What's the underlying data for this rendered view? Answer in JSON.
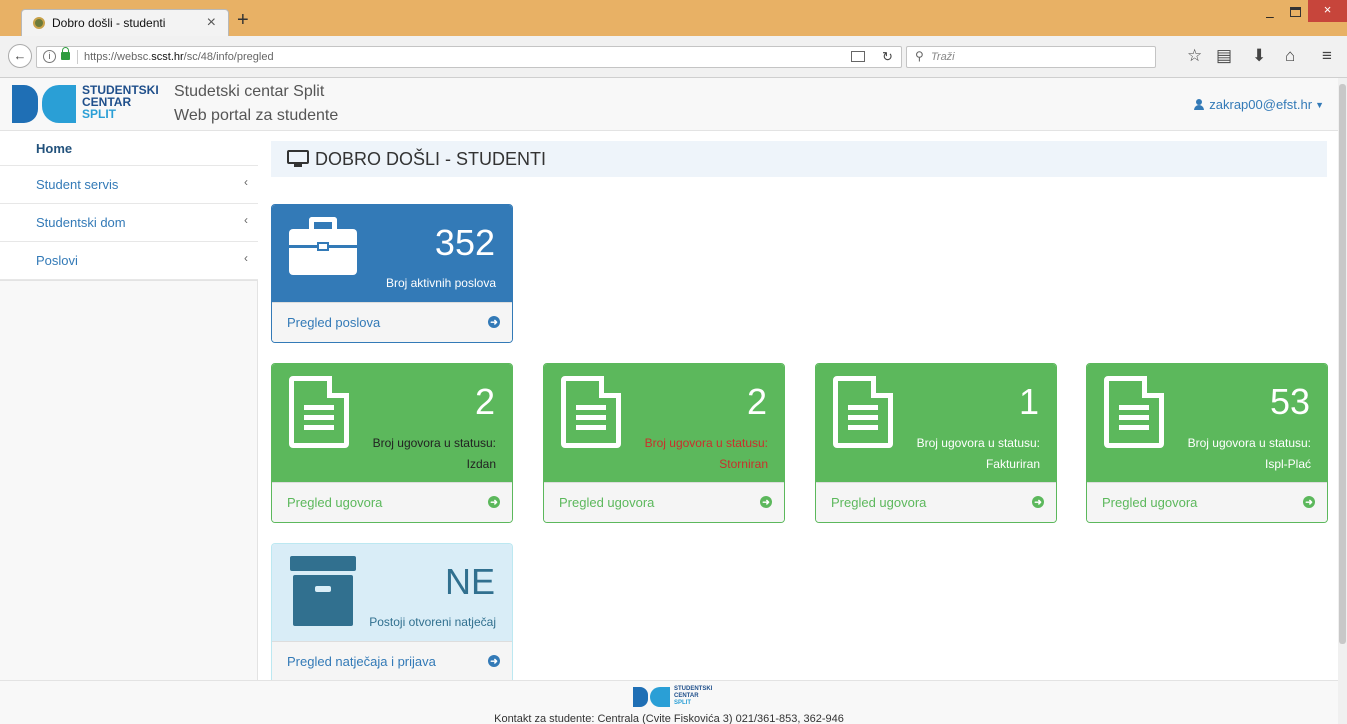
{
  "browser": {
    "tab_title": "Dobro došli - studenti",
    "tab_close": "×",
    "new_tab": "+",
    "url_prefix": "https://websc.",
    "url_host": "scst.hr",
    "url_path": "/sc/48/info/pregled",
    "search_placeholder": "Traži",
    "window_minimize": "–",
    "window_close": "×"
  },
  "header": {
    "logo_line1": "STUDENTSKI",
    "logo_line2": "CENTAR",
    "logo_line3": "SPLIT",
    "brand_line1": "Studetski centar Split",
    "brand_line2": "Web portal za studente",
    "user_email": "zakrap00@efst.hr"
  },
  "sidebar": {
    "items": [
      {
        "label": "Home"
      },
      {
        "label": "Student servis"
      },
      {
        "label": "Studentski dom"
      },
      {
        "label": "Poslovi"
      }
    ]
  },
  "main": {
    "page_title": "DOBRO DOŠLI - STUDENTI",
    "jobs_card": {
      "value": "352",
      "label": "Broj aktivnih poslova",
      "link": "Pregled poslova"
    },
    "contract_cards": [
      {
        "value": "2",
        "label_line1": "Broj ugovora u statusu:",
        "label_line2": "Izdan",
        "link": "Pregled ugovora",
        "label_color": "#222222"
      },
      {
        "value": "2",
        "label_line1": "Broj ugovora u statusu:",
        "label_line2": "Storniran",
        "link": "Pregled ugovora",
        "label_color": "#c9302c"
      },
      {
        "value": "1",
        "label_line1": "Broj ugovora u statusu:",
        "label_line2": "Fakturiran",
        "link": "Pregled ugovora",
        "label_color": "#ffffff"
      },
      {
        "value": "53",
        "label_line1": "Broj ugovora u statusu:",
        "label_line2": "Ispl-Plać",
        "link": "Pregled ugovora",
        "label_color": "#ffffff"
      }
    ],
    "tender_card": {
      "value": "NE",
      "label": "Postoji otvoreni natječaj",
      "link": "Pregled natječaja i prijava"
    }
  },
  "footer": {
    "logo_line1": "STUDENTSKI",
    "logo_line2": "CENTAR",
    "logo_line3": "SPLIT",
    "contact": "Kontakt za studente: Centrala (Cvite Fiskovića 3) 021/361-853, 362-946"
  },
  "colors": {
    "primary": "#337ab7",
    "success": "#5cb85c",
    "info_bg": "#d9edf7",
    "browser_tabbar": "#e8b165"
  }
}
